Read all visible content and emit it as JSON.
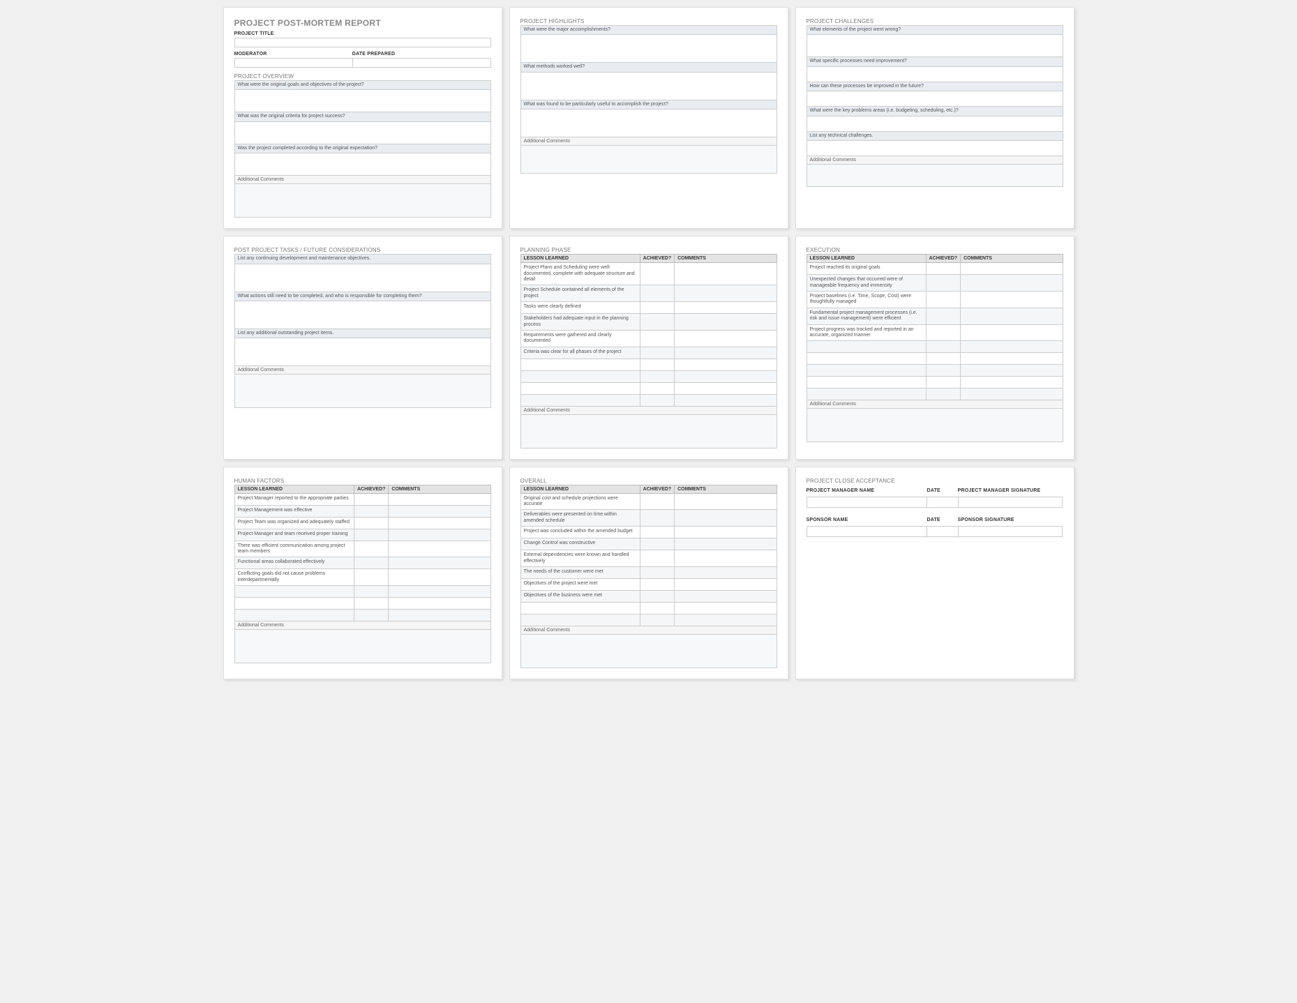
{
  "panel1": {
    "title": "PROJECT POST-MORTEM REPORT",
    "projectTitleLabel": "PROJECT TITLE",
    "moderatorLabel": "MODERATOR",
    "datePreparedLabel": "DATE PREPARED",
    "overviewTitle": "PROJECT OVERVIEW",
    "q1": "What were the original goals and objectives of the project?",
    "q2": "What was the original criteria for project success?",
    "q3": "Was the project completed according to the original expectation?",
    "commentsLabel": "Additional Comments"
  },
  "panel2": {
    "title": "PROJECT HIGHLIGHTS",
    "q1": "What were the major accomplishments?",
    "q2": "What methods worked well?",
    "q3": "What was found to be particularly useful to accomplish the project?",
    "commentsLabel": "Additional Comments"
  },
  "panel3": {
    "title": "PROJECT CHALLENGES",
    "q1": "What elements of the project went wrong?",
    "q2": "What specific processes need improvement?",
    "q3": "How can these processes be improved in the future?",
    "q4": "What were the key problems areas (i.e. budgeting, scheduling, etc.)?",
    "q5": "List any technical challenges.",
    "commentsLabel": "Additional Comments"
  },
  "panel4": {
    "title": "POST PROJECT TASKS / FUTURE CONSIDERATIONS",
    "q1": "List any continuing development and maintenance objectives.",
    "q2": "What actions still need to be completed, and who is responsible for completing them?",
    "q3": "List any additional outstanding project items.",
    "commentsLabel": "Additional Comments"
  },
  "tableHeaders": {
    "lesson": "LESSON LEARNED",
    "achieved": "ACHIEVED?",
    "comments": "COMMENTS"
  },
  "panel5": {
    "title": "PLANNING PHASE",
    "rows": [
      "Project Plans and Scheduling were well-documented, complete with adequate structure and detail",
      "Project Schedule contained all elements of the project",
      "Tasks were clearly defined",
      "Stakeholders had adequate input in the planning process",
      "Requirements were gathered and clearly documented",
      "Criteria was clear for all phases of the project",
      "",
      "",
      "",
      ""
    ],
    "commentsLabel": "Additional Comments"
  },
  "panel6": {
    "title": "EXECUTION",
    "rows": [
      "Project reached its original goals",
      "Unexpected changes that occurred were of manageable frequency and immensity",
      "Project baselines (i.e. Time, Scope, Cost) were thoughtfully managed",
      "Fundamental project management processes (i.e. risk and issue management) were efficient",
      "Project progress was tracked and reported in an accurate, organized manner",
      "",
      "",
      "",
      "",
      ""
    ],
    "commentsLabel": "Additional Comments"
  },
  "panel7": {
    "title": "HUMAN FACTORS",
    "rows": [
      "Project Manager reported to the appropriate parties",
      "Project Management was effective",
      "Project Team was organized and adequately staffed",
      "Project Manager and team received proper training",
      "There was efficient communication among project team members",
      "Functional areas collaborated effectively",
      "Conflicting goals did not cause problems interdepartmentally",
      "",
      "",
      ""
    ],
    "commentsLabel": "Additional Comments"
  },
  "panel8": {
    "title": "OVERALL",
    "rows": [
      "Original cost and schedule projections were accurate",
      "Deliverables were presented on time within amended schedule",
      "Project was concluded within the amended budget",
      "Change Control was constructive",
      "External dependencies were known and handled effectively",
      "The needs of the customer were met",
      "Objectives of the project were met",
      "Objectives of the business were met",
      "",
      ""
    ],
    "commentsLabel": "Additional Comments"
  },
  "panel9": {
    "title": "PROJECT CLOSE ACCEPTANCE",
    "row1": {
      "c1": "PROJECT MANAGER NAME",
      "c2": "DATE",
      "c3": "PROJECT MANAGER SIGNATURE"
    },
    "row2": {
      "c1": "SPONSOR NAME",
      "c2": "DATE",
      "c3": "SPONSOR SIGNATURE"
    }
  }
}
